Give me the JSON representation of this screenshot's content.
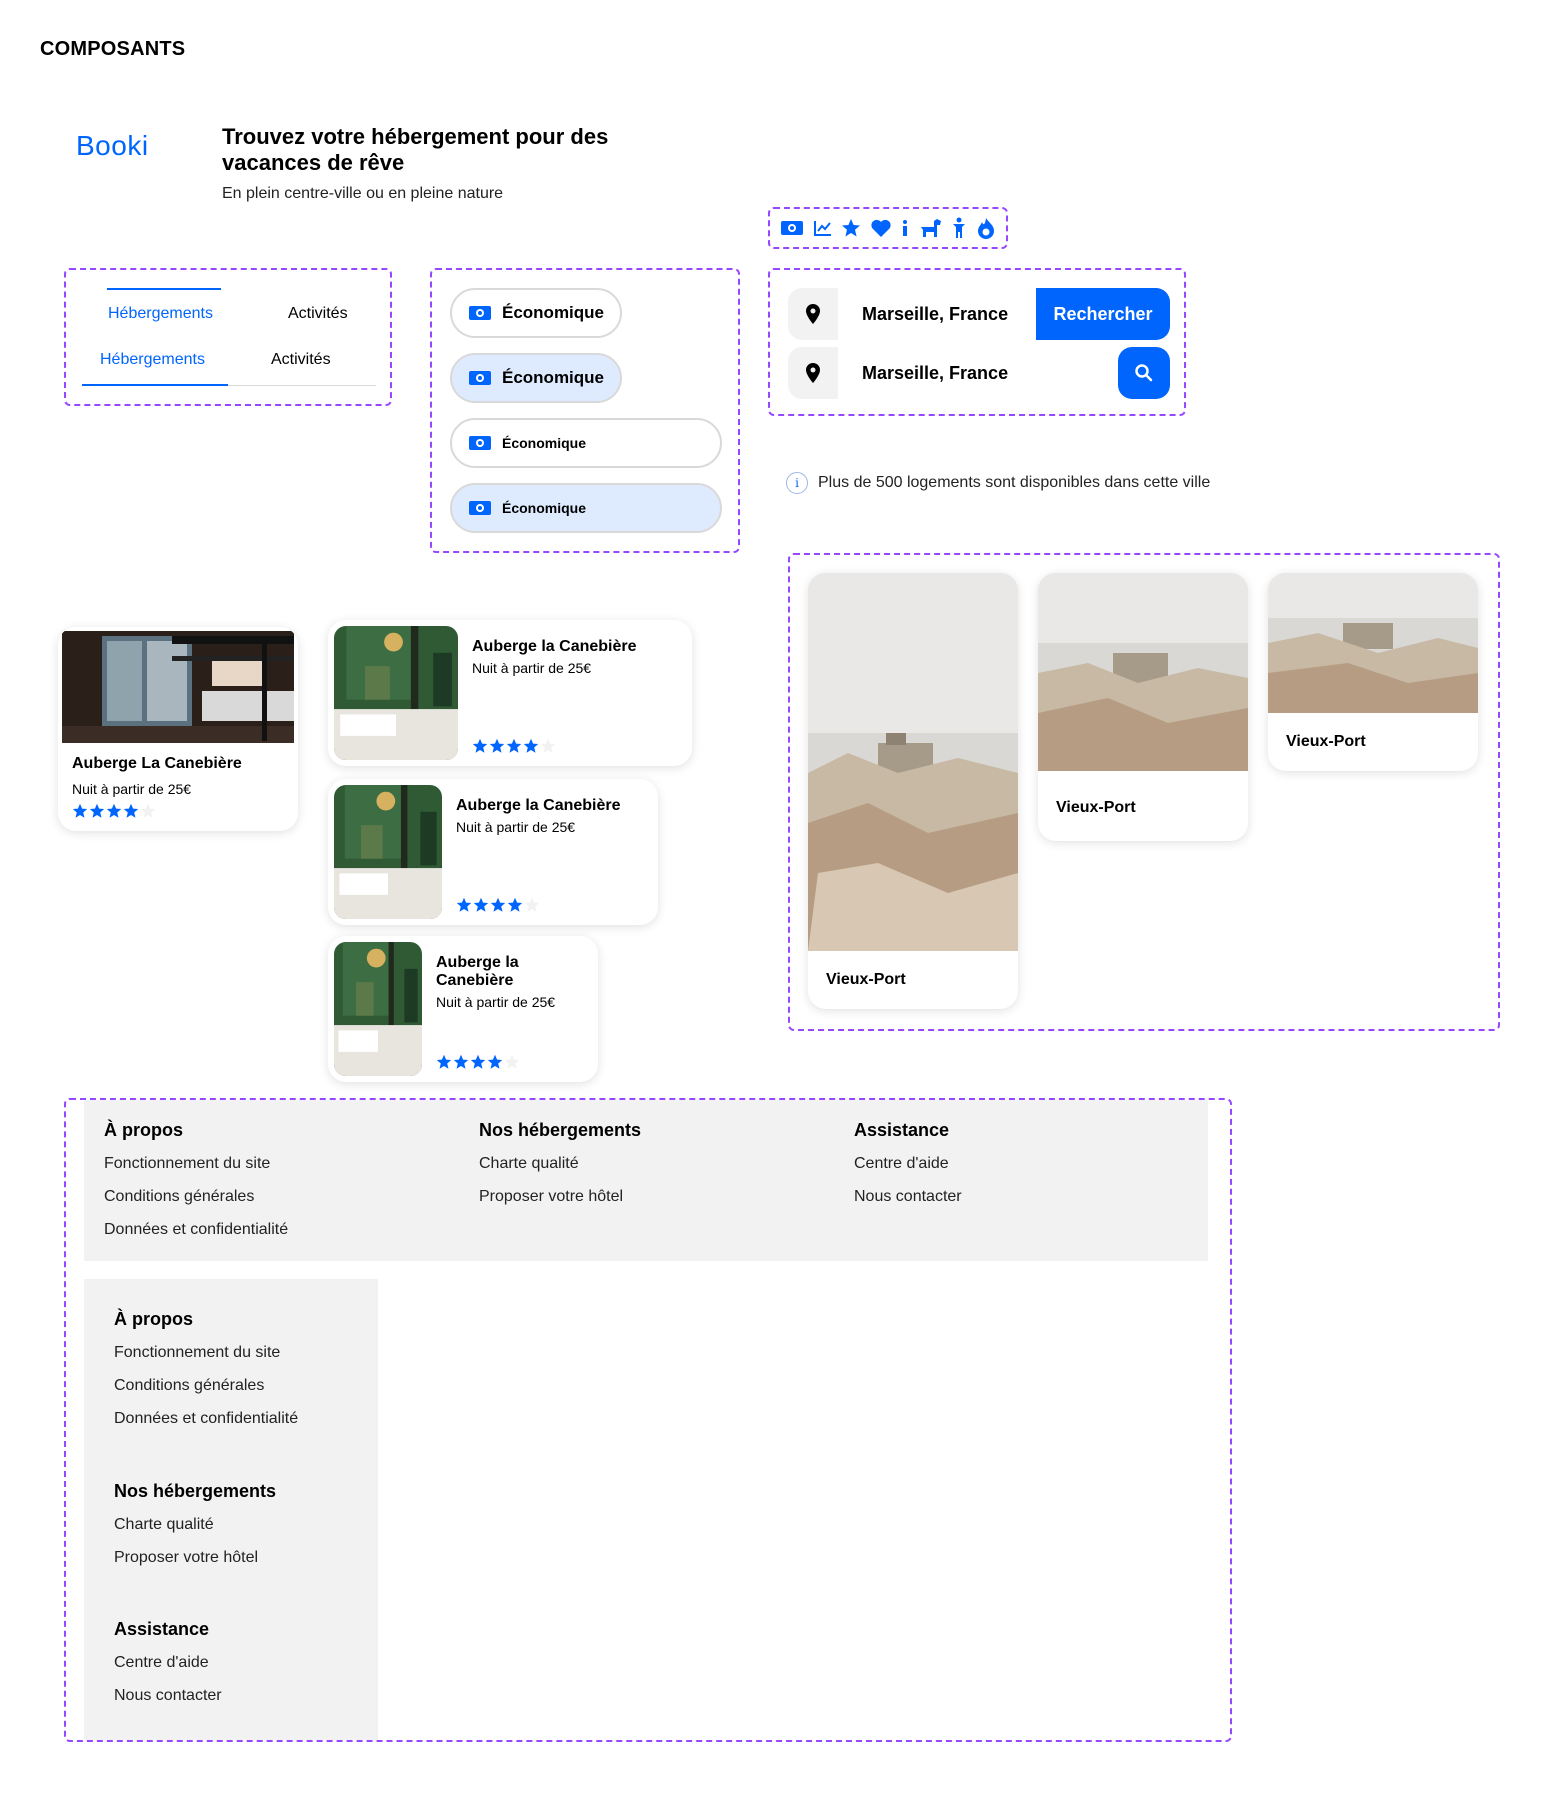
{
  "page": {
    "title": "COMPOSANTS"
  },
  "logo": {
    "text": "Booki"
  },
  "hero": {
    "title": "Trouvez votre hébergement pour des vacances de rêve",
    "subtitle": "En plein centre-ville ou en pleine nature"
  },
  "icons": [
    "money-icon",
    "trending-icon",
    "star-icon",
    "heart-icon",
    "info-icon",
    "dog-icon",
    "child-icon",
    "fire-icon"
  ],
  "tabs": {
    "desktop": [
      "Hébergements",
      "Activités"
    ],
    "mobile": [
      "Hébergements",
      "Activités"
    ]
  },
  "filters": [
    "Économique",
    "Économique",
    "Économique",
    "Économique"
  ],
  "search": {
    "value": "Marseille, France",
    "button_label": "Rechercher"
  },
  "info": {
    "text": "Plus de 500 logements sont disponibles dans cette ville"
  },
  "cards": {
    "vertical": {
      "name": "Auberge La Canebière",
      "price": "Nuit à partir de 25€",
      "rating": 4
    },
    "horizontal": [
      {
        "name": "Auberge la Canebière",
        "price": "Nuit à partir de 25€",
        "rating": 4
      },
      {
        "name": "Auberge la Canebière",
        "price": "Nuit à partir de 25€",
        "rating": 4
      },
      {
        "name": "Auberge la Canebière",
        "price": "Nuit à partir de 25€",
        "rating": 4
      }
    ]
  },
  "popular": [
    "Vieux-Port",
    "Vieux-Port",
    "Vieux-Port"
  ],
  "footer": {
    "columns": [
      {
        "title": "À propos",
        "links": [
          "Fonctionnement du site",
          "Conditions générales",
          "Données et confidentialité"
        ]
      },
      {
        "title": "Nos hébergements",
        "links": [
          "Charte qualité",
          "Proposer votre hôtel"
        ]
      },
      {
        "title": "Assistance",
        "links": [
          "Centre d'aide",
          "Nous contacter"
        ]
      }
    ]
  },
  "colors": {
    "primary": "#0065fc",
    "primary_light": "#deebff",
    "grey_bg": "#f2f2f2",
    "dashed": "#9747ff",
    "star_empty": "#f2f2f2"
  }
}
